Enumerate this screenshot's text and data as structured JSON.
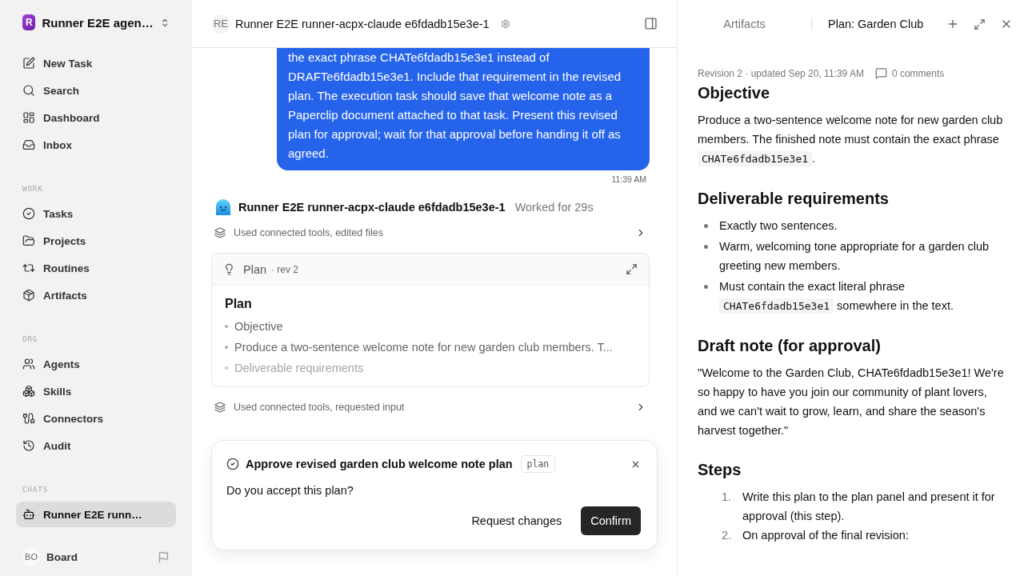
{
  "workspace": {
    "initial": "R",
    "name": "Runner E2E agen…"
  },
  "nav_sections": [
    {
      "items": [
        {
          "label": "New Task",
          "selected": false
        },
        {
          "label": "Search",
          "selected": false
        },
        {
          "label": "Dashboard",
          "selected": false
        },
        {
          "label": "Inbox",
          "selected": false
        }
      ]
    },
    {
      "heading": "WORK",
      "items": [
        {
          "label": "Tasks",
          "selected": false
        },
        {
          "label": "Projects",
          "selected": false
        },
        {
          "label": "Routines",
          "selected": false
        },
        {
          "label": "Artifacts",
          "selected": false
        }
      ]
    },
    {
      "heading": "ORG",
      "items": [
        {
          "label": "Agents",
          "selected": false
        },
        {
          "label": "Skills",
          "selected": false
        },
        {
          "label": "Connectors",
          "selected": false
        },
        {
          "label": "Audit",
          "selected": false
        }
      ]
    },
    {
      "heading": "CHATS",
      "items": [
        {
          "label": "Runner E2E runn…",
          "selected": true
        }
      ]
    }
  ],
  "user_footer": {
    "initials": "BO",
    "name": "Board"
  },
  "chat_header": {
    "avatar": "RE",
    "title": "Runner E2E runner-acpx-claude e6fdadb15e3e-1"
  },
  "user_message": {
    "text": "the exact phrase CHATe6fdadb15e3e1 instead of DRAFTe6fdadb15e3e1. Include that requirement in the revised plan. The execution task should save that welcome note as a Paperclip document attached to that task. Present this revised plan for approval; wait for that approval before handing it off as agreed.",
    "time": "11:39 AM"
  },
  "agent_message": {
    "name": "Runner E2E runner-acpx-claude e6fdadb15e3e-1",
    "status": "Worked for 29s"
  },
  "tool_rows": [
    {
      "label": "Used connected tools, edited files"
    },
    {
      "label": "Used connected tools, requested input"
    }
  ],
  "plan_card": {
    "title": "Plan",
    "revision": "· rev 2",
    "heading": "Plan",
    "items": [
      "Objective",
      "Produce a two-sentence welcome note for new garden club members. T...",
      "Deliverable requirements"
    ]
  },
  "approval": {
    "title": "Approve revised garden club welcome note plan",
    "tag": "plan",
    "question": "Do you accept this plan?",
    "buttons": [
      {
        "label": "Request changes",
        "kind": "secondary"
      },
      {
        "label": "Confirm",
        "kind": "primary"
      }
    ]
  },
  "panel": {
    "tabs": [
      {
        "label": "Artifacts",
        "selected": false
      },
      {
        "label": "Plan: Garden Club",
        "selected": true
      }
    ],
    "meta": "Revision 2 · updated Sep 20, 11:39 AM",
    "comments": "0 comments",
    "blocks": [
      {
        "kind": "heading",
        "text": "Objective"
      },
      {
        "kind": "paragraph",
        "parts": [
          {
            "kind": "text",
            "text": "Produce a two-sentence welcome note for new garden club members. The finished note must contain the exact phrase "
          },
          {
            "kind": "code",
            "text": "CHATe6fdadb15e3e1"
          },
          {
            "kind": "text",
            "text": "."
          }
        ]
      },
      {
        "kind": "heading",
        "text": "Deliverable requirements"
      },
      {
        "kind": "bullets",
        "items": [
          [
            {
              "kind": "text",
              "text": "Exactly two sentences."
            }
          ],
          [
            {
              "kind": "text",
              "text": "Warm, welcoming tone appropriate for a garden club greeting new members."
            }
          ],
          [
            {
              "kind": "text",
              "text": "Must contain the exact literal phrase "
            },
            {
              "kind": "code",
              "text": "CHATe6fdadb15e3e1"
            },
            {
              "kind": "text",
              "text": " somewhere in the text."
            }
          ]
        ]
      },
      {
        "kind": "heading",
        "text": "Draft note (for approval)"
      },
      {
        "kind": "paragraph",
        "parts": [
          {
            "kind": "text",
            "text": "\"Welcome to the Garden Club, CHATe6fdadb15e3e1! We're so happy to have you join our community of plant lovers, and we can't wait to grow, learn, and share the season's harvest together.\""
          }
        ]
      },
      {
        "kind": "heading",
        "text": "Steps"
      },
      {
        "kind": "numbered",
        "items": [
          {
            "number": "1.",
            "parts": [
              {
                "kind": "text",
                "text": "Write this plan to the plan panel and present it for approval (this step)."
              }
            ]
          },
          {
            "number": "2.",
            "parts": [
              {
                "kind": "text",
                "text": "On approval of the final revision:"
              }
            ]
          }
        ]
      }
    ]
  }
}
